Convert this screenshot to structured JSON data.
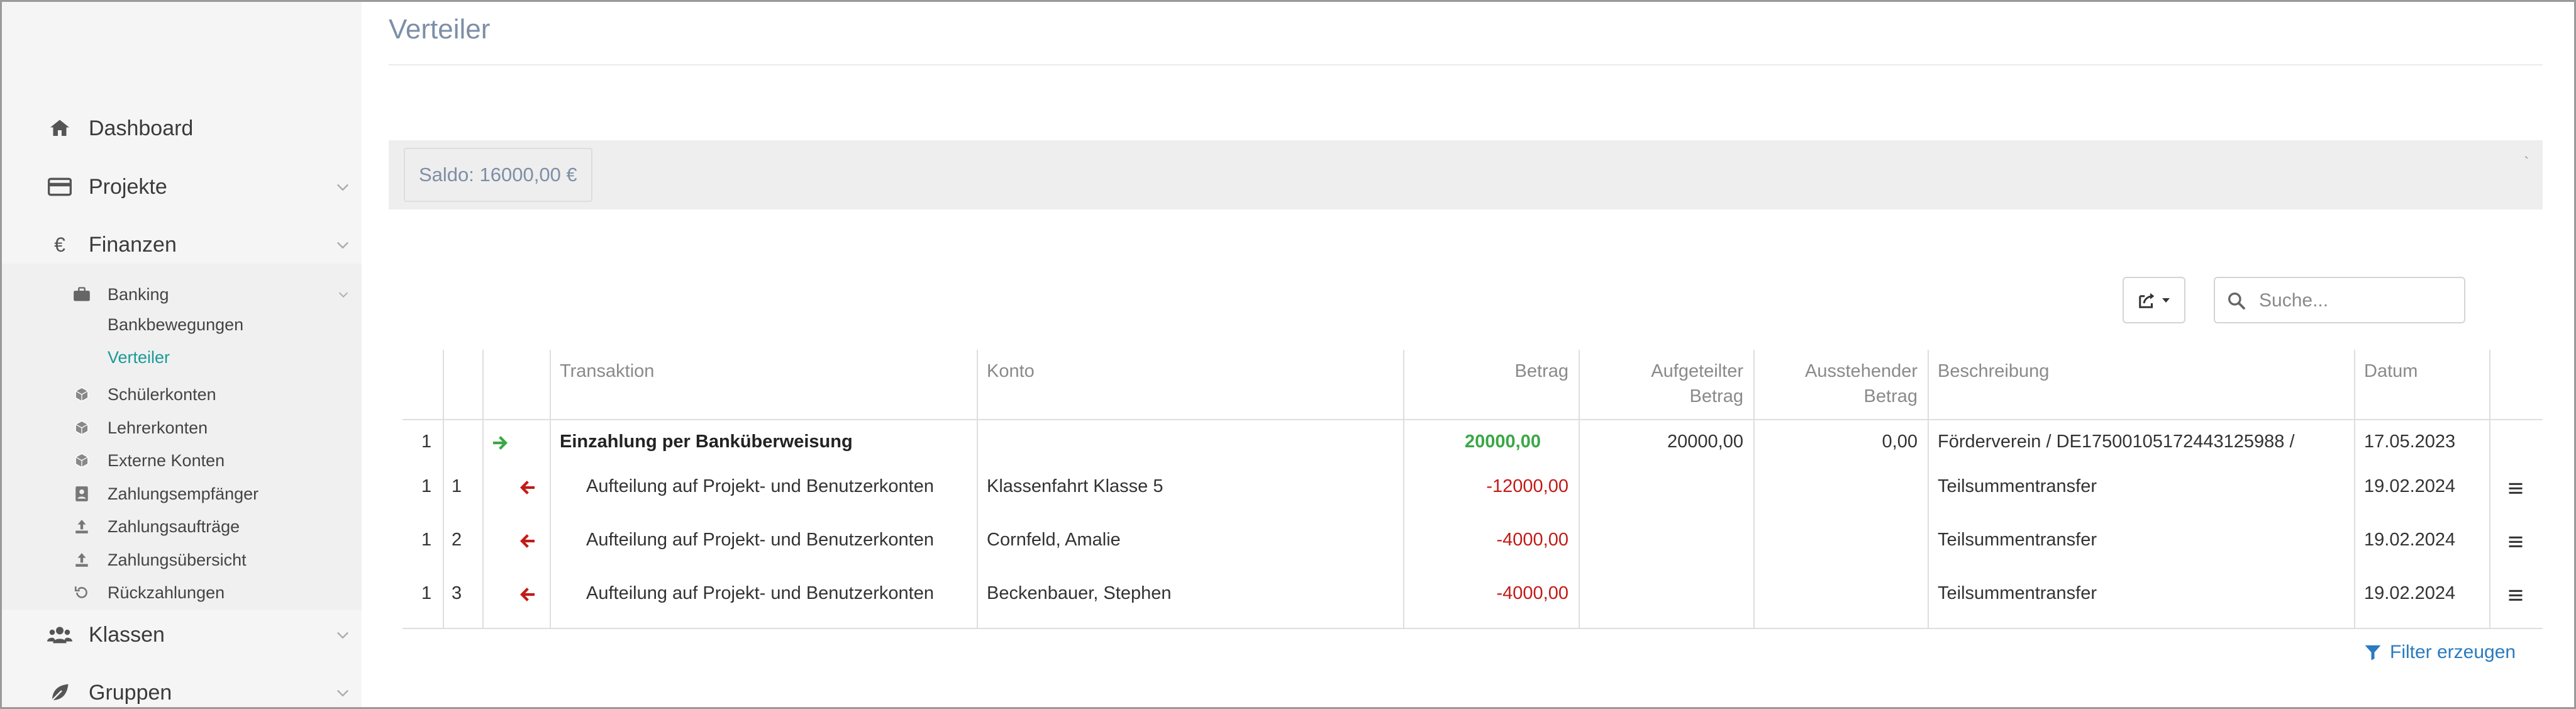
{
  "colors": {
    "accent_teal": "#1a9b97",
    "title": "#7d8fa8",
    "positive": "#3aa845",
    "negative": "#c21b17",
    "link": "#2a7bbf"
  },
  "sidebar": {
    "items": [
      {
        "label": "Dashboard",
        "icon": "home-icon"
      },
      {
        "label": "Projekte",
        "icon": "credit-card-icon"
      },
      {
        "label": "Finanzen",
        "icon": "euro-icon",
        "glyph": "€"
      },
      {
        "label": "Klassen",
        "icon": "users-icon"
      },
      {
        "label": "Gruppen",
        "icon": "leaf-icon"
      }
    ],
    "finanzen_sub": [
      {
        "label": "Banking",
        "icon": "briefcase-icon"
      },
      {
        "label": "Schülerkonten",
        "icon": "cube-icon"
      },
      {
        "label": "Lehrerkonten",
        "icon": "cube-icon"
      },
      {
        "label": "Externe Konten",
        "icon": "cube-icon"
      },
      {
        "label": "Zahlungsempfänger",
        "icon": "contact-card-icon"
      },
      {
        "label": "Zahlungsaufträge",
        "icon": "upload-icon"
      },
      {
        "label": "Zahlungsübersicht",
        "icon": "upload-icon"
      },
      {
        "label": "Rückzahlungen",
        "icon": "undo-icon"
      }
    ],
    "banking_sub": [
      {
        "label": "Bankbewegungen",
        "active": false
      },
      {
        "label": "Verteiler",
        "active": true
      }
    ]
  },
  "page": {
    "title": "Verteiler",
    "saldo": "Saldo: 16000,00 €",
    "saldo_tick": "`"
  },
  "toolbar": {
    "export_icon": "export-icon",
    "search_placeholder": "Suche..."
  },
  "table": {
    "headers": {
      "transaktion": "Transaktion",
      "konto": "Konto",
      "betrag": "Betrag",
      "aufgeteilter_1": "Aufgeteilter",
      "aufgeteilter_2": "Betrag",
      "ausstehender_1": "Ausstehender",
      "ausstehender_2": "Betrag",
      "beschreibung": "Beschreibung",
      "datum": "Datum"
    },
    "rows": [
      {
        "c1": "1",
        "c2": "",
        "arrow": "arrow-right-icon",
        "transaktion": "Einzahlung per Banküberweisung",
        "konto": "",
        "betrag": "20000,00",
        "aufgeteilt": "20000,00",
        "ausstehend": "0,00",
        "beschreibung": "Förderverein / DE17500105172443125988 /",
        "datum": "17.05.2023"
      },
      {
        "c1": "1",
        "c2": "1",
        "arrow": "arrow-left-icon",
        "transaktion": "Aufteilung auf Projekt- und Benutzerkonten",
        "konto": "Klassenfahrt Klasse 5",
        "betrag": "-12000,00",
        "aufgeteilt": "",
        "ausstehend": "",
        "beschreibung": "Teilsummentransfer",
        "datum": "19.02.2024"
      },
      {
        "c1": "1",
        "c2": "2",
        "arrow": "arrow-left-icon",
        "transaktion": "Aufteilung auf Projekt- und Benutzerkonten",
        "konto": "Cornfeld, Amalie",
        "betrag": "-4000,00",
        "aufgeteilt": "",
        "ausstehend": "",
        "beschreibung": "Teilsummentransfer",
        "datum": "19.02.2024"
      },
      {
        "c1": "1",
        "c2": "3",
        "arrow": "arrow-left-icon",
        "transaktion": "Aufteilung auf Projekt- und Benutzerkonten",
        "konto": "Beckenbauer, Stephen",
        "betrag": "-4000,00",
        "aufgeteilt": "",
        "ausstehend": "",
        "beschreibung": "Teilsummentransfer",
        "datum": "19.02.2024"
      }
    ]
  },
  "footer": {
    "filter_label": "Filter erzeugen",
    "filter_icon": "filter-icon"
  }
}
